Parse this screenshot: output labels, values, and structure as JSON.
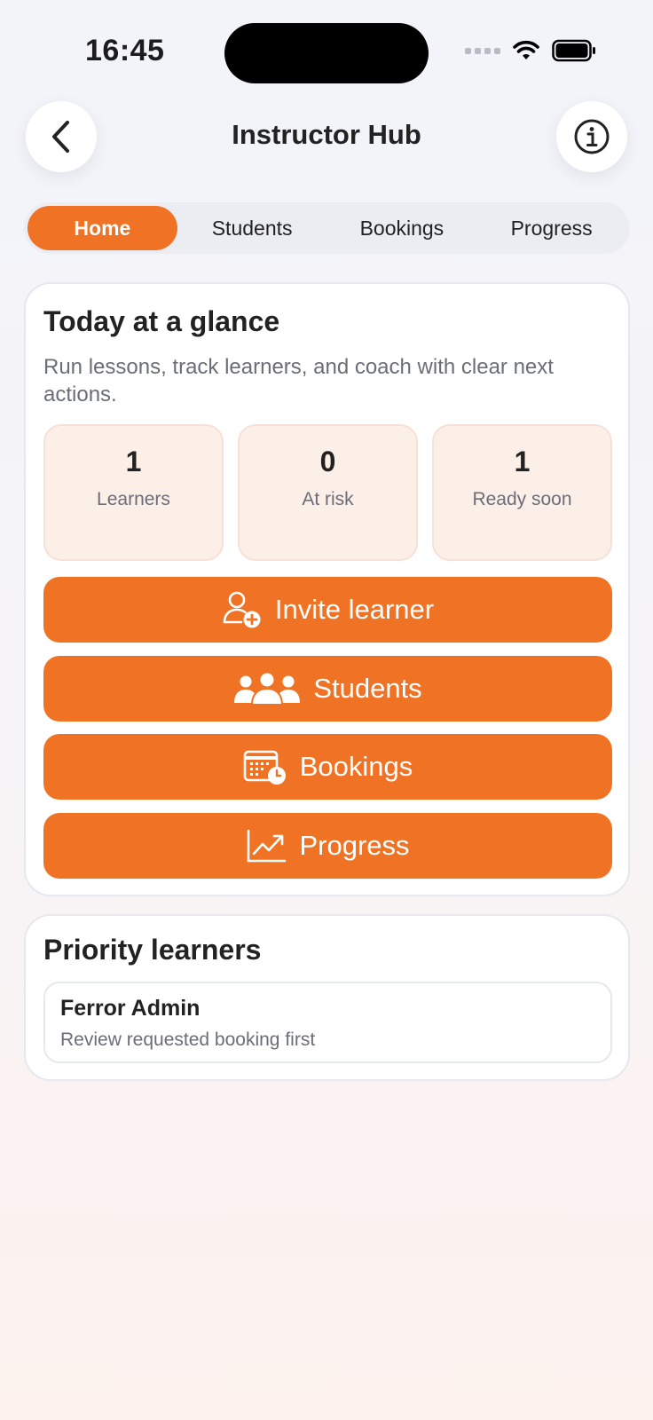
{
  "status_bar": {
    "time": "16:45"
  },
  "header": {
    "title": "Instructor Hub",
    "back_icon": "chevron-left-icon",
    "info_icon": "info-icon"
  },
  "tabs": [
    {
      "label": "Home",
      "active": true
    },
    {
      "label": "Students",
      "active": false
    },
    {
      "label": "Bookings",
      "active": false
    },
    {
      "label": "Progress",
      "active": false
    }
  ],
  "glance": {
    "title": "Today at a glance",
    "subtitle": "Run lessons, track learners, and coach with clear next actions.",
    "stats": [
      {
        "value": "1",
        "label": "Learners"
      },
      {
        "value": "0",
        "label": "At risk"
      },
      {
        "value": "1",
        "label": "Ready soon"
      }
    ],
    "actions": [
      {
        "label": "Invite learner",
        "icon": "person-add-icon"
      },
      {
        "label": "Students",
        "icon": "group-icon"
      },
      {
        "label": "Bookings",
        "icon": "calendar-clock-icon"
      },
      {
        "label": "Progress",
        "icon": "chart-line-icon"
      }
    ]
  },
  "priority": {
    "title": "Priority learners",
    "learners": [
      {
        "name": "Ferror Admin",
        "note": "Review requested booking first"
      }
    ]
  },
  "colors": {
    "accent": "#f07325",
    "stat_bg": "#fcefe8",
    "muted_text": "#6b6d78"
  }
}
